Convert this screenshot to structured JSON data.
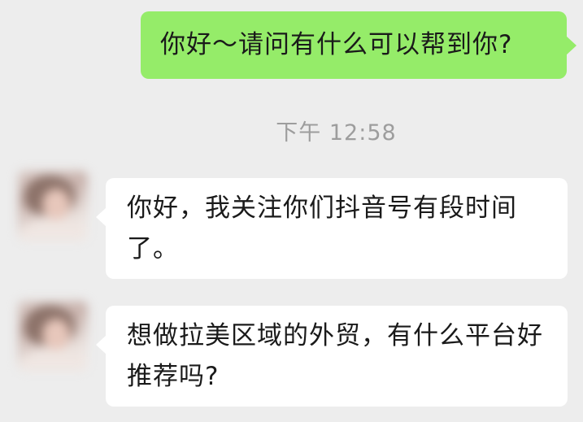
{
  "messages": {
    "outgoing_1": "你好～请问有什么可以帮到你?",
    "timestamp": "下午 12:58",
    "incoming_1": "你好，我关注你们抖音号有段时间了。",
    "incoming_2": "想做拉美区域的外贸，有什么平台好推荐吗?"
  },
  "colors": {
    "background": "#ededed",
    "outgoing_bubble": "#95ec69",
    "incoming_bubble": "#ffffff",
    "timestamp_text": "#9d9d9d"
  }
}
